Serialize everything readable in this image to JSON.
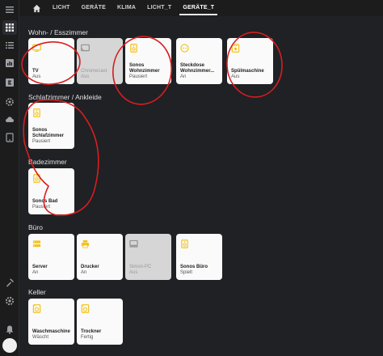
{
  "nav": {
    "tabs": [
      "LICHT",
      "GERÄTE",
      "KLIMA",
      "LICHT_T",
      "GERÄTE_T"
    ],
    "active_tab": "GERÄTE_T"
  },
  "sidebar": {
    "icons": [
      "grid-icon",
      "list-icon",
      "chart-icon",
      "energy-icon",
      "settings-gear-icon",
      "cloud-icon",
      "tablet-icon",
      "hammer-icon",
      "cog-icon",
      "bell-icon"
    ]
  },
  "sections": [
    {
      "title": "Wohn- / Esszimmer",
      "cards": [
        {
          "name": "TV",
          "state": "Aus",
          "icon": "tv-icon",
          "off": false
        },
        {
          "name": "Chromecast",
          "state": "Aus",
          "icon": "cast-icon",
          "off": true
        },
        {
          "name": "Sonos Wohnzimmer",
          "state": "Pausiert",
          "icon": "speaker-icon",
          "off": false
        },
        {
          "name": "Steckdose Wohnzimmer...",
          "state": "An",
          "icon": "socket-icon",
          "off": false
        },
        {
          "name": "Spülmaschine",
          "state": "Aus",
          "icon": "dishwasher-icon",
          "off": false
        }
      ]
    },
    {
      "title": "Schlafzimmer / Ankleide",
      "cards": [
        {
          "name": "Sonos Schlafzimmer",
          "state": "Pausiert",
          "icon": "speaker-icon",
          "off": false
        }
      ]
    },
    {
      "title": "Badezimmer",
      "cards": [
        {
          "name": "Sonos Bad",
          "state": "Pausiert",
          "icon": "speaker-icon",
          "off": false
        }
      ]
    },
    {
      "title": "Büro",
      "cards": [
        {
          "name": "Server",
          "state": "An",
          "icon": "server-icon",
          "off": false
        },
        {
          "name": "Drucker",
          "state": "An",
          "icon": "printer-icon",
          "off": false
        },
        {
          "name": "Simon-PC",
          "state": "Aus",
          "icon": "computer-icon",
          "off": true
        },
        {
          "name": "Sonos Büro",
          "state": "Spielt",
          "icon": "speaker-icon",
          "off": false
        }
      ]
    },
    {
      "title": "Keller",
      "cards": [
        {
          "name": "Waschmaschine",
          "state": "Wäscht",
          "icon": "washer-icon",
          "off": false
        },
        {
          "name": "Trockner",
          "state": "Fertig",
          "icon": "washer-icon",
          "off": false
        }
      ]
    }
  ]
}
